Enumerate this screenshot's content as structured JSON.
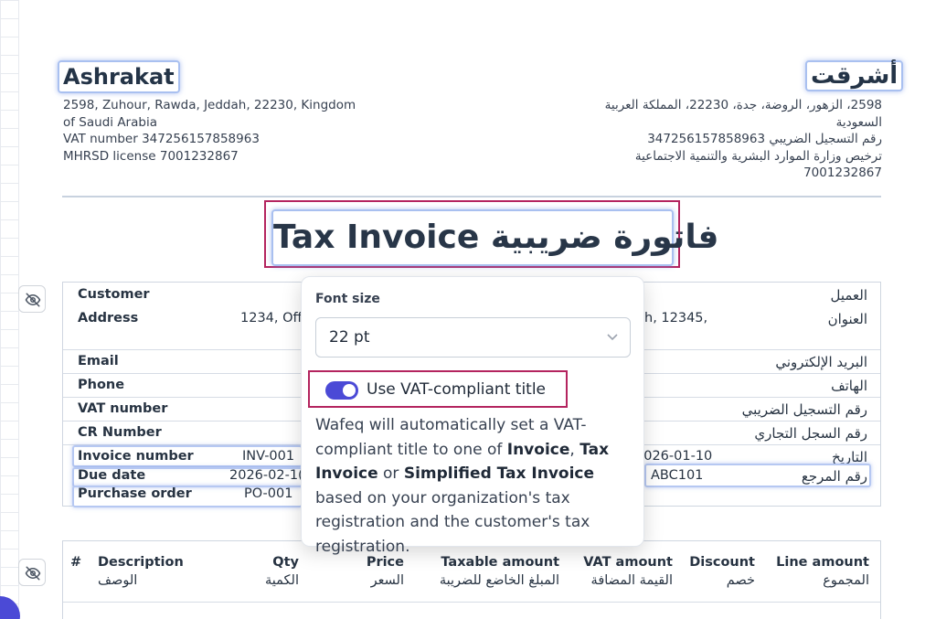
{
  "company": {
    "name_en": "Ashrakat",
    "name_ar": "أشرقت",
    "address_en": [
      "2598, Zuhour, Rawda, Jeddah, 22230, Kingdom",
      "of Saudi Arabia",
      "VAT number 347256157858963",
      "MHRSD license 7001232867"
    ],
    "address_ar": [
      "2598، الزهور، الروضة، جدة، 22230، المملكة العربية",
      "السعودية",
      "رقم التسجيل الضريبي 347256157858963",
      "ترخيص وزارة الموارد البشرية والتنمية الاجتماعية",
      "7001232867"
    ]
  },
  "invoice_title": "Tax Invoice فاتورة ضريبية",
  "customer_table": {
    "rows": [
      {
        "label": "Customer",
        "value": "",
        "label_ar": "العميل"
      },
      {
        "label": "Address",
        "value": "1234, Off",
        "value_right": "h, 12345,",
        "label_ar": "العنوان"
      },
      {
        "label": "Email",
        "value": "",
        "label_ar": "البريد الإلكتروني"
      },
      {
        "label": "Phone",
        "value": "",
        "label_ar": "الهاتف"
      },
      {
        "label": "VAT number",
        "value": "",
        "label_ar": "رقم التسجيل الضريبي"
      },
      {
        "label": "CR Number",
        "value": "",
        "label_ar": "رقم السجل التجاري"
      }
    ],
    "meta": [
      {
        "label": "Invoice number",
        "value": "INV-001",
        "right_value": "2026-01-10",
        "label_ar": "التاريخ"
      },
      {
        "label": "Due date",
        "value": "2026-02-1(",
        "right_value": "ABC101",
        "label_ar": "رقم المرجع"
      },
      {
        "label": "Purchase order",
        "value": "PO-001"
      }
    ]
  },
  "items_table": {
    "headers": [
      {
        "en": "#",
        "ar": ""
      },
      {
        "en": "Description",
        "ar": "الوصف"
      },
      {
        "en": "Qty",
        "ar": "الكمية"
      },
      {
        "en": "Price",
        "ar": "السعر"
      },
      {
        "en": "Taxable amount",
        "ar": "المبلغ الخاضع للضريبة"
      },
      {
        "en": "VAT amount",
        "ar": "القيمة المضافة"
      },
      {
        "en": "Discount",
        "ar": "خصم"
      },
      {
        "en": "Line amount",
        "ar": "المجموع"
      }
    ]
  },
  "popover": {
    "font_size_label": "Font size",
    "font_size_value": "22 pt",
    "toggle_label": "Use VAT-compliant title",
    "toggle_on": true,
    "help": {
      "t1": "Wafeq will automatically set a VAT-compliant title to one of ",
      "b1": "Invoice",
      "t2": ", ",
      "b2": "Tax Invoice",
      "t3": " or ",
      "b3": "Simplified Tax Invoice",
      "t4": " based on your organization's tax registration and the customer's tax registration."
    }
  },
  "icons": [
    "eye-off-icon",
    "chevron-down-icon"
  ],
  "colors": {
    "accent": "#4b4ad6",
    "highlight": "#b4245f"
  }
}
